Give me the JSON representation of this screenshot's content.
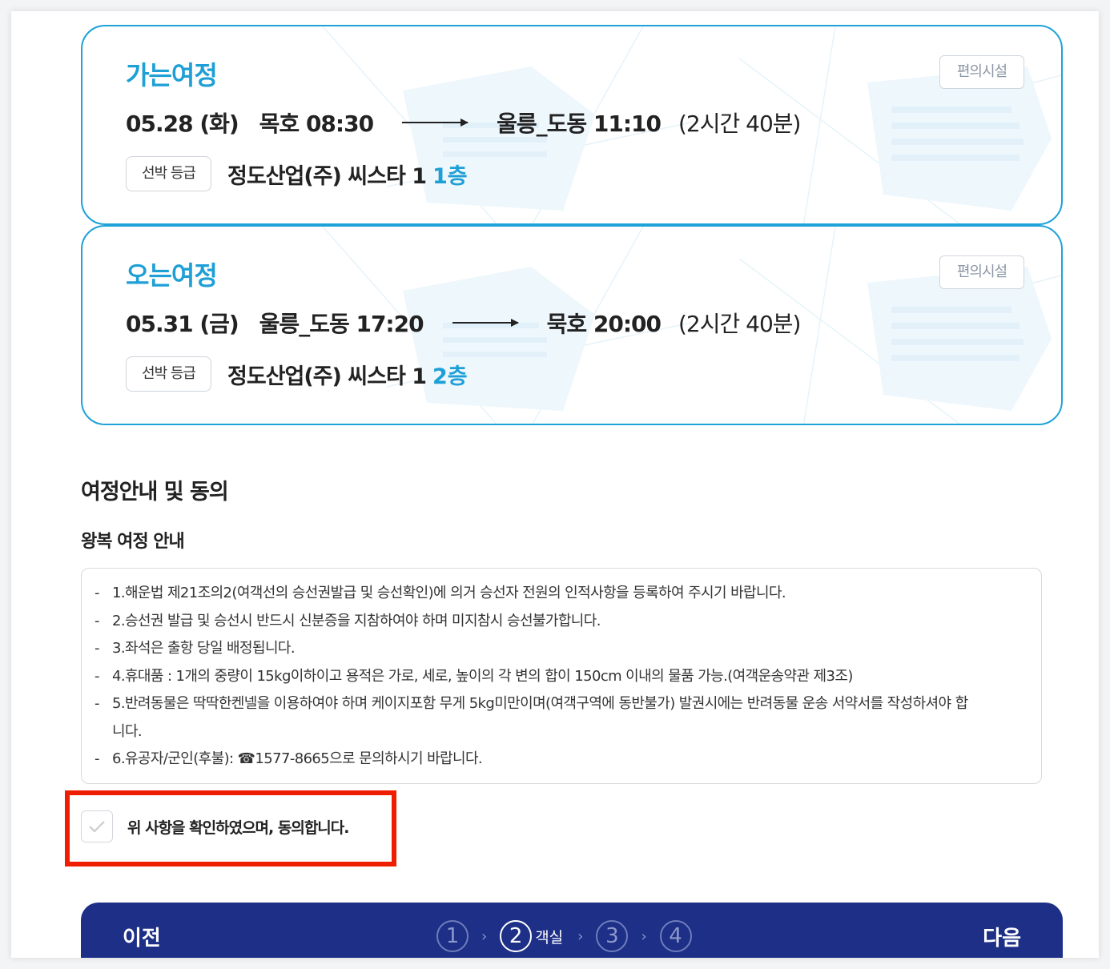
{
  "outbound": {
    "title": "가는여정",
    "facility_label": "편의시설",
    "date": "05.28 (화)",
    "depart": "목호 08:30",
    "arrive": "울릉_도동 11:10",
    "duration": "(2시간 40분)",
    "grade_label": "선박 등급",
    "ship": "정도산업(주) 씨스타 1",
    "floor": "1층"
  },
  "return": {
    "title": "오는여정",
    "facility_label": "편의시설",
    "date": "05.31 (금)",
    "depart": "울릉_도동 17:20",
    "arrive": "묵호 20:00",
    "duration": "(2시간 40분)",
    "grade_label": "선박 등급",
    "ship": "정도산업(주) 씨스타 1",
    "floor": "2층"
  },
  "guide": {
    "section_title": "여정안내 및 동의",
    "sub_title": "왕복 여정 안내",
    "notices": [
      "1.해운법 제21조의2(여객선의 승선권발급 및 승선확인)에 의거 승선자 전원의 인적사항을 등록하여 주시기 바랍니다.",
      "2.승선권 발급 및 승선시 반드시 신분증을 지참하여야 하며 미지참시 승선불가합니다.",
      "3.좌석은 출항 당일 배정됩니다.",
      "4.휴대품 : 1개의 중량이 15kg이하이고 용적은 가로, 세로, 높이의 각 변의 합이 150cm 이내의 물품 가능.(여객운송약관 제3조)",
      "5.반려동물은 딱딱한켄넬을 이용하여야 하며 케이지포함 무게 5kg미만이며(여객구역에 동반불가) 발권시에는 반려동물 운송 서약서를 작성하셔야 합니다.",
      "6.유공자/군인(후불): ☎1577-8665으로 문의하시기 바랍니다."
    ],
    "agree_label": "위 사항을 확인하였으며, 동의합니다."
  },
  "nav": {
    "prev": "이전",
    "next": "다음",
    "steps": [
      "1",
      "2",
      "3",
      "4"
    ],
    "active_step_label": "객실",
    "separator": "›"
  },
  "colors": {
    "accent": "#1e9fd6",
    "nav_bg": "#1d2f86",
    "highlight": "#f01e00"
  }
}
